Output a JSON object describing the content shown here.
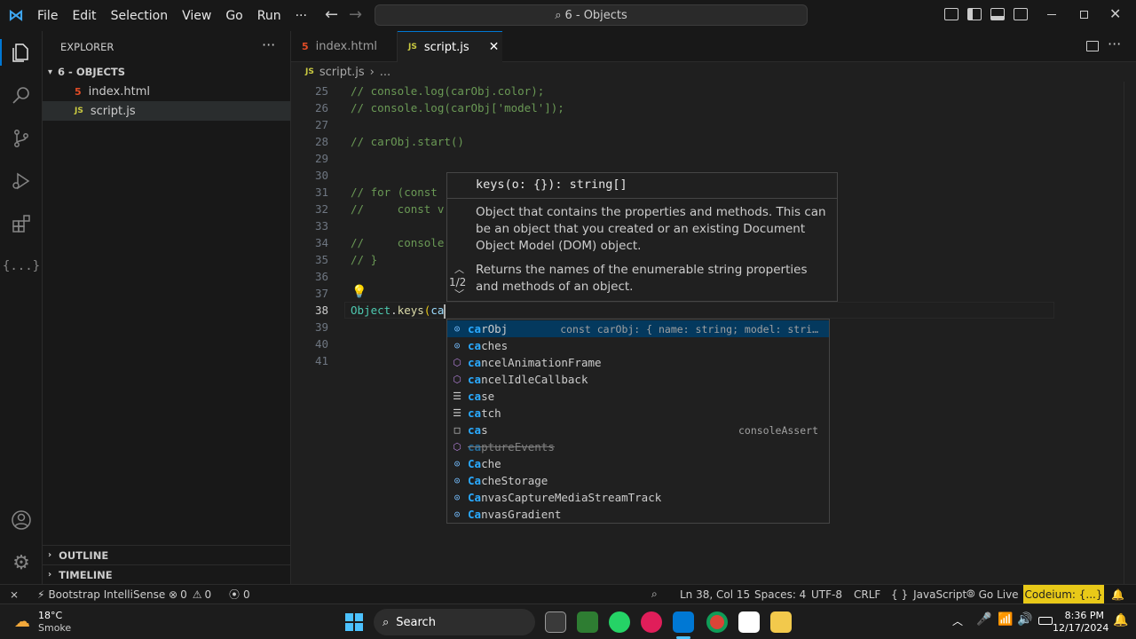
{
  "menu": [
    "File",
    "Edit",
    "Selection",
    "View",
    "Go",
    "Run",
    "···"
  ],
  "search_title": "6 - Objects",
  "sidebar": {
    "header": "EXPLORER",
    "folder": "6 - OBJECTS",
    "files": [
      "index.html",
      "script.js"
    ],
    "outline": "OUTLINE",
    "timeline": "TIMELINE"
  },
  "tabs": [
    {
      "label": "index.html",
      "icon": "5",
      "active": false
    },
    {
      "label": "script.js",
      "icon": "JS",
      "active": true
    }
  ],
  "breadcrumb": {
    "file": "script.js",
    "more": "..."
  },
  "code_lines": [
    {
      "n": "25",
      "text": "// console.log(carObj.color);"
    },
    {
      "n": "26",
      "text": "// console.log(carObj['model']);"
    },
    {
      "n": "27",
      "text": ""
    },
    {
      "n": "28",
      "text": "// carObj.start()"
    },
    {
      "n": "29",
      "text": ""
    },
    {
      "n": "30",
      "text": ""
    },
    {
      "n": "31",
      "text": "// for (const"
    },
    {
      "n": "32",
      "text": "//     const v"
    },
    {
      "n": "33",
      "text": ""
    },
    {
      "n": "34",
      "text": "//     console"
    },
    {
      "n": "35",
      "text": "// }"
    },
    {
      "n": "36",
      "text": ""
    },
    {
      "n": "37",
      "text": ""
    },
    {
      "n": "38",
      "text": "Object.keys(ca"
    },
    {
      "n": "39",
      "text": ""
    },
    {
      "n": "40",
      "text": ""
    },
    {
      "n": "41",
      "text": ""
    }
  ],
  "current_line": {
    "obj": "Object",
    "dot": ".",
    "method": "keys",
    "paren": "(",
    "typed": "ca"
  },
  "hover": {
    "signature": "keys(o: {}): string[]",
    "param_doc": "Object that contains the properties and methods. This can be an object that you created or an existing Document Object Model (DOM) object.",
    "doc": "Returns the names of the enumerable string properties and methods of an object.",
    "overload": "1/2"
  },
  "suggestions": [
    {
      "hl": "ca",
      "rest": "rObj",
      "kind": "variable",
      "detail": "const carObj: { name: string; model: stri…",
      "selected": true
    },
    {
      "hl": "ca",
      "rest": "ches",
      "kind": "variable",
      "detail": ""
    },
    {
      "hl": "ca",
      "rest": "ncelAnimationFrame",
      "kind": "method",
      "detail": ""
    },
    {
      "hl": "ca",
      "rest": "ncelIdleCallback",
      "kind": "method",
      "detail": ""
    },
    {
      "hl": "ca",
      "rest": "se",
      "kind": "keyword",
      "detail": ""
    },
    {
      "hl": "ca",
      "rest": "tch",
      "kind": "keyword",
      "detail": ""
    },
    {
      "hl": "ca",
      "rest": "s",
      "kind": "snippet",
      "detail": "consoleAssert"
    },
    {
      "hl": "ca",
      "rest": "ptureEvents",
      "kind": "method",
      "detail": "",
      "deprecated": true
    },
    {
      "hl": "Ca",
      "rest": "che",
      "kind": "variable",
      "detail": ""
    },
    {
      "hl": "Ca",
      "rest": "cheStorage",
      "kind": "variable",
      "detail": ""
    },
    {
      "hl": "Ca",
      "rest": "nvasCaptureMediaStreamTrack",
      "kind": "variable",
      "detail": ""
    },
    {
      "hl": "Ca",
      "rest": "nvasGradient",
      "kind": "variable",
      "detail": ""
    }
  ],
  "status": {
    "remote": "⨯",
    "bootstrap": "Bootstrap IntelliSense",
    "errors": "0",
    "warnings": "0",
    "ports": "0",
    "position": "Ln 38, Col 15",
    "spaces": "Spaces: 4",
    "encoding": "UTF-8",
    "eol": "CRLF",
    "language": "JavaScript",
    "golive": "Go Live",
    "codeium": "Codeium: {...}"
  },
  "taskbar": {
    "weather_temp": "18°C",
    "weather_desc": "Smoke",
    "search": "Search",
    "time": "8:36 PM",
    "date": "12/17/2024"
  },
  "colors": {
    "accent": "#0078d4",
    "codeium_bg": "#e8c918",
    "js_yellow": "#cbcb41",
    "html_red": "#e34c26"
  }
}
